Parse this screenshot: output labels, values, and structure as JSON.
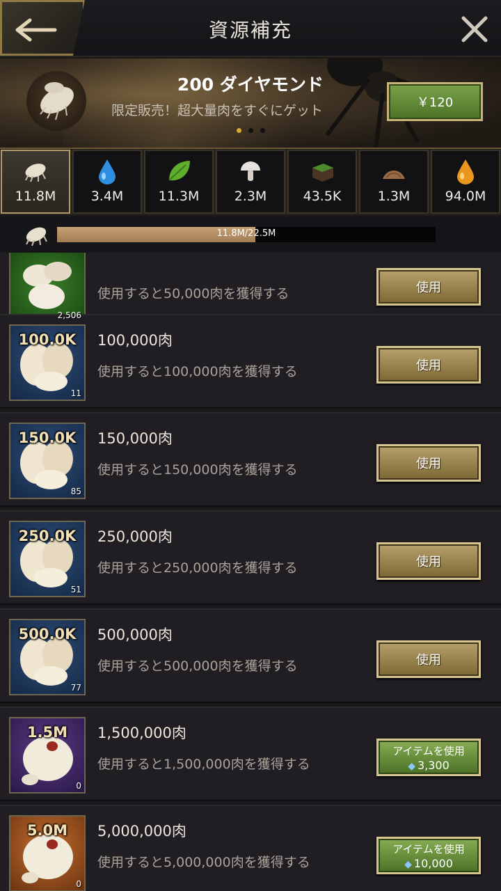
{
  "header": {
    "title": "資源補充"
  },
  "banner": {
    "title": "200 ダイヤモンド",
    "subtitle": "限定販売！超大量肉をすぐにゲット",
    "price": "￥120"
  },
  "resources": [
    {
      "icon": "meat-larva-icon",
      "value": "11.8M"
    },
    {
      "icon": "water-drop-icon",
      "value": "3.4M"
    },
    {
      "icon": "leaf-icon",
      "value": "11.3M"
    },
    {
      "icon": "mushroom-icon",
      "value": "2.3M"
    },
    {
      "icon": "soil-icon",
      "value": "43.5K"
    },
    {
      "icon": "sand-icon",
      "value": "1.3M"
    },
    {
      "icon": "honey-drop-icon",
      "value": "94.0M"
    }
  ],
  "progress": {
    "text": "11.8M/22.5M",
    "fraction": 0.524
  },
  "items": [
    {
      "tag": "",
      "count": "2,506",
      "name": "",
      "desc": "使用すると50,000肉を獲得する",
      "button": "使用",
      "color": "green"
    },
    {
      "tag": "100.0K",
      "count": "11",
      "name": "100,000肉",
      "desc": "使用すると100,000肉を獲得する",
      "button": "使用",
      "color": "blue"
    },
    {
      "tag": "150.0K",
      "count": "85",
      "name": "150,000肉",
      "desc": "使用すると150,000肉を獲得する",
      "button": "使用",
      "color": "blue"
    },
    {
      "tag": "250.0K",
      "count": "51",
      "name": "250,000肉",
      "desc": "使用すると250,000肉を獲得する",
      "button": "使用",
      "color": "blue"
    },
    {
      "tag": "500.0K",
      "count": "77",
      "name": "500,000肉",
      "desc": "使用すると500,000肉を獲得する",
      "button": "使用",
      "color": "blue"
    },
    {
      "tag": "1.5M",
      "count": "0",
      "name": "1,500,000肉",
      "desc": "使用すると1,500,000肉を獲得する",
      "button": "アイテムを使用",
      "cost": "3,300",
      "color": "purple"
    },
    {
      "tag": "5.0M",
      "count": "0",
      "name": "5,000,000肉",
      "desc": "使用すると5,000,000肉を獲得する",
      "button": "アイテムを使用",
      "cost": "10,000",
      "color": "orange"
    }
  ]
}
